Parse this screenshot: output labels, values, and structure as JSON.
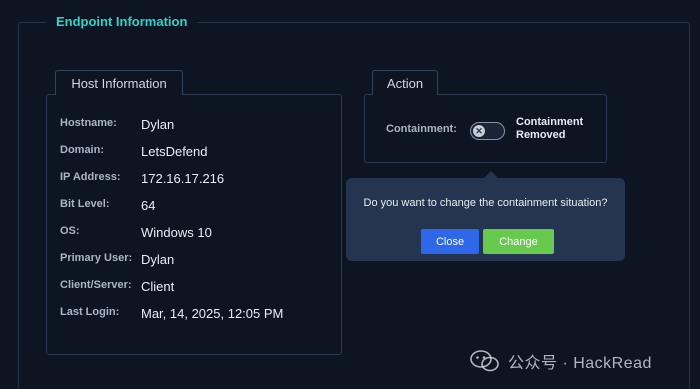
{
  "endpoint": {
    "title": "Endpoint Information"
  },
  "host": {
    "title": "Host Information",
    "rows": [
      {
        "label": "Hostname:",
        "value": "Dylan"
      },
      {
        "label": "Domain:",
        "value": "LetsDefend"
      },
      {
        "label": "IP Address:",
        "value": "172.16.17.216"
      },
      {
        "label": "Bit Level:",
        "value": "64"
      },
      {
        "label": "OS:",
        "value": "Windows 10"
      },
      {
        "label": "Primary User:",
        "value": "Dylan"
      },
      {
        "label": "Client/Server:",
        "value": "Client"
      },
      {
        "label": "Last Login:",
        "value": "Mar, 14, 2025, 12:05 PM"
      }
    ]
  },
  "action": {
    "title": "Action",
    "containment_label": "Containment:",
    "toggle_icon": "close-icon",
    "toggle_glyph": "✕",
    "toggle_on": false,
    "status_line1": "Containment",
    "status_line2": "Removed"
  },
  "popover": {
    "question": "Do you want to change the containment situation?",
    "close_label": "Close",
    "change_label": "Change"
  },
  "watermark": {
    "text": "公众号 · HackRead"
  },
  "colors": {
    "accent": "#2fd3c7",
    "close_button": "#2e67e8",
    "change_button": "#67c94d",
    "background": "#0d1523"
  }
}
